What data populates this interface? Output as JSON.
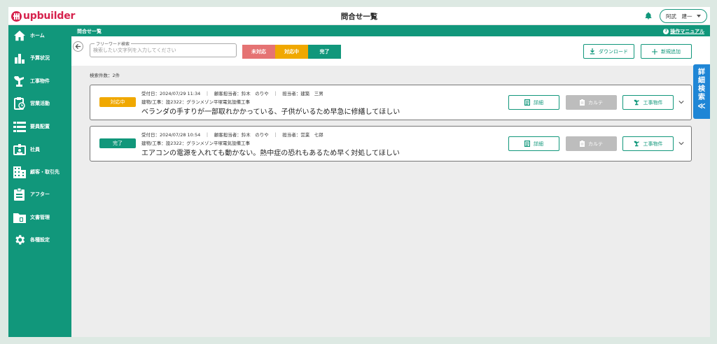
{
  "app": {
    "logo_text": "upbuilder",
    "page_title": "問合せ一覧",
    "user_name": "阿武　建一"
  },
  "sidebar": {
    "items": [
      {
        "label": "ホーム",
        "icon": "home-icon"
      },
      {
        "label": "予算状況",
        "icon": "bar-chart-icon"
      },
      {
        "label": "工事物件",
        "icon": "construction-icon"
      },
      {
        "label": "営業活動",
        "icon": "clipboard-clock-icon"
      },
      {
        "label": "要員配置",
        "icon": "list-icon"
      },
      {
        "label": "社員",
        "icon": "badge-icon"
      },
      {
        "label": "顧客・取引先",
        "icon": "building-icon"
      },
      {
        "label": "アフター",
        "icon": "assignment-icon"
      },
      {
        "label": "文書管理",
        "icon": "folder-icon"
      },
      {
        "label": "各種設定",
        "icon": "gear-icon"
      }
    ]
  },
  "subbar": {
    "breadcrumb": "問合せ一覧",
    "manual": "操作マニュアル"
  },
  "search": {
    "legend": "フリーワード検索",
    "placeholder": "検索したい文字列を入力してください",
    "tabs": [
      {
        "label": "未対応",
        "color": "#e57373"
      },
      {
        "label": "対応中",
        "color": "#f0a800"
      },
      {
        "label": "完了",
        "color": "#11977b"
      }
    ],
    "download_label": "ダウンロード",
    "add_label": "新規追加"
  },
  "result_count": "検索件数：2件",
  "inquiries": [
    {
      "status": "対応中",
      "status_color": "#f0a800",
      "meta_line": "受付日：2024/07/29 11:34　｜　顧客担当者：鈴木　のりや　｜　担当者：建築　三男",
      "project_line": "建物/工事：設2322：グランメゾン平塚電気設備工事",
      "title": "ベランダの手すりが一部取れかかっている、子供がいるため早急に修繕してほしい"
    },
    {
      "status": "完了",
      "status_color": "#11977b",
      "meta_line": "受付日：2024/07/28 10:54　｜　顧客担当者：鈴木　のりや　｜　担当者：営業　七郎",
      "project_line": "建物/工事：設2322：グランメゾン平塚電気設備工事",
      "title": "エアコンの電源を入れても動かない。熱中症の恐れもあるため早く対処してほしい"
    }
  ],
  "card_buttons": {
    "detail": "詳細",
    "karte": "カルテ",
    "koji": "工事物件"
  },
  "advanced_search": {
    "line1": "詳",
    "line2": "細",
    "line3": "検",
    "line4": "索",
    "chevron": "≪"
  },
  "colors": {
    "brand_green": "#11977b",
    "logo_red": "#d6224d",
    "adv_blue": "#1f86d6"
  }
}
